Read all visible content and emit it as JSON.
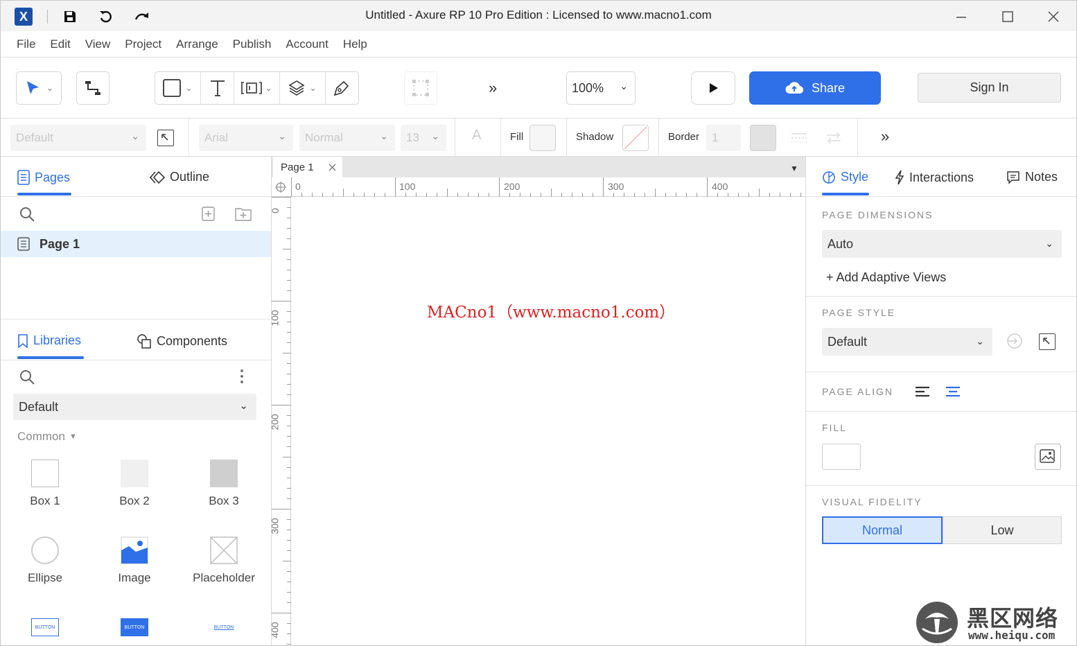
{
  "window": {
    "title": "Untitled - Axure RP 10 Pro Edition : Licensed to www.macno1.com",
    "app_logo": "X"
  },
  "menu": [
    "File",
    "Edit",
    "View",
    "Project",
    "Arrange",
    "Publish",
    "Account",
    "Help"
  ],
  "toolbar": {
    "zoom": "100%",
    "share_label": "Share",
    "signin_label": "Sign In",
    "more_glyph": "»"
  },
  "format": {
    "style_value": "Default",
    "font_value": "Arial",
    "weight_value": "Normal",
    "size_value": "13",
    "fill_label": "Fill",
    "shadow_label": "Shadow",
    "border_label": "Border",
    "border_value": "1",
    "text_glyph": "A"
  },
  "pages_panel": {
    "tab_pages": "Pages",
    "tab_outline": "Outline",
    "page_item": "Page 1"
  },
  "libraries_panel": {
    "tab_libraries": "Libraries",
    "tab_components": "Components",
    "library_value": "Default",
    "category": "Common",
    "widgets": [
      {
        "label": "Box 1"
      },
      {
        "label": "Box 2"
      },
      {
        "label": "Box 3"
      },
      {
        "label": "Ellipse"
      },
      {
        "label": "Image"
      },
      {
        "label": "Placeholder"
      }
    ],
    "button_widget_text": "BUTTON"
  },
  "canvas": {
    "tab_label": "Page 1",
    "h_ruler": [
      "0",
      "100",
      "200",
      "300",
      "400"
    ],
    "v_ruler": [
      "0",
      "100",
      "200",
      "300",
      "400"
    ],
    "watermark": "MACno1（www.macno1.com）"
  },
  "style_panel": {
    "tab_style": "Style",
    "tab_interactions": "Interactions",
    "tab_notes": "Notes",
    "dimensions_head": "PAGE DIMENSIONS",
    "dimensions_value": "Auto",
    "add_adaptive": "+ Add Adaptive Views",
    "page_style_head": "PAGE STYLE",
    "page_style_value": "Default",
    "page_align_head": "PAGE ALIGN",
    "fill_head": "FILL",
    "fidelity_head": "VISUAL FIDELITY",
    "fidelity_normal": "Normal",
    "fidelity_low": "Low"
  },
  "corner_watermark": {
    "title": "黑区网络",
    "url": "www.heiqu.com"
  },
  "colors": {
    "accent": "#2f6fe8",
    "selected_row": "#e4f1fd",
    "watermark_red": "#e02020"
  }
}
